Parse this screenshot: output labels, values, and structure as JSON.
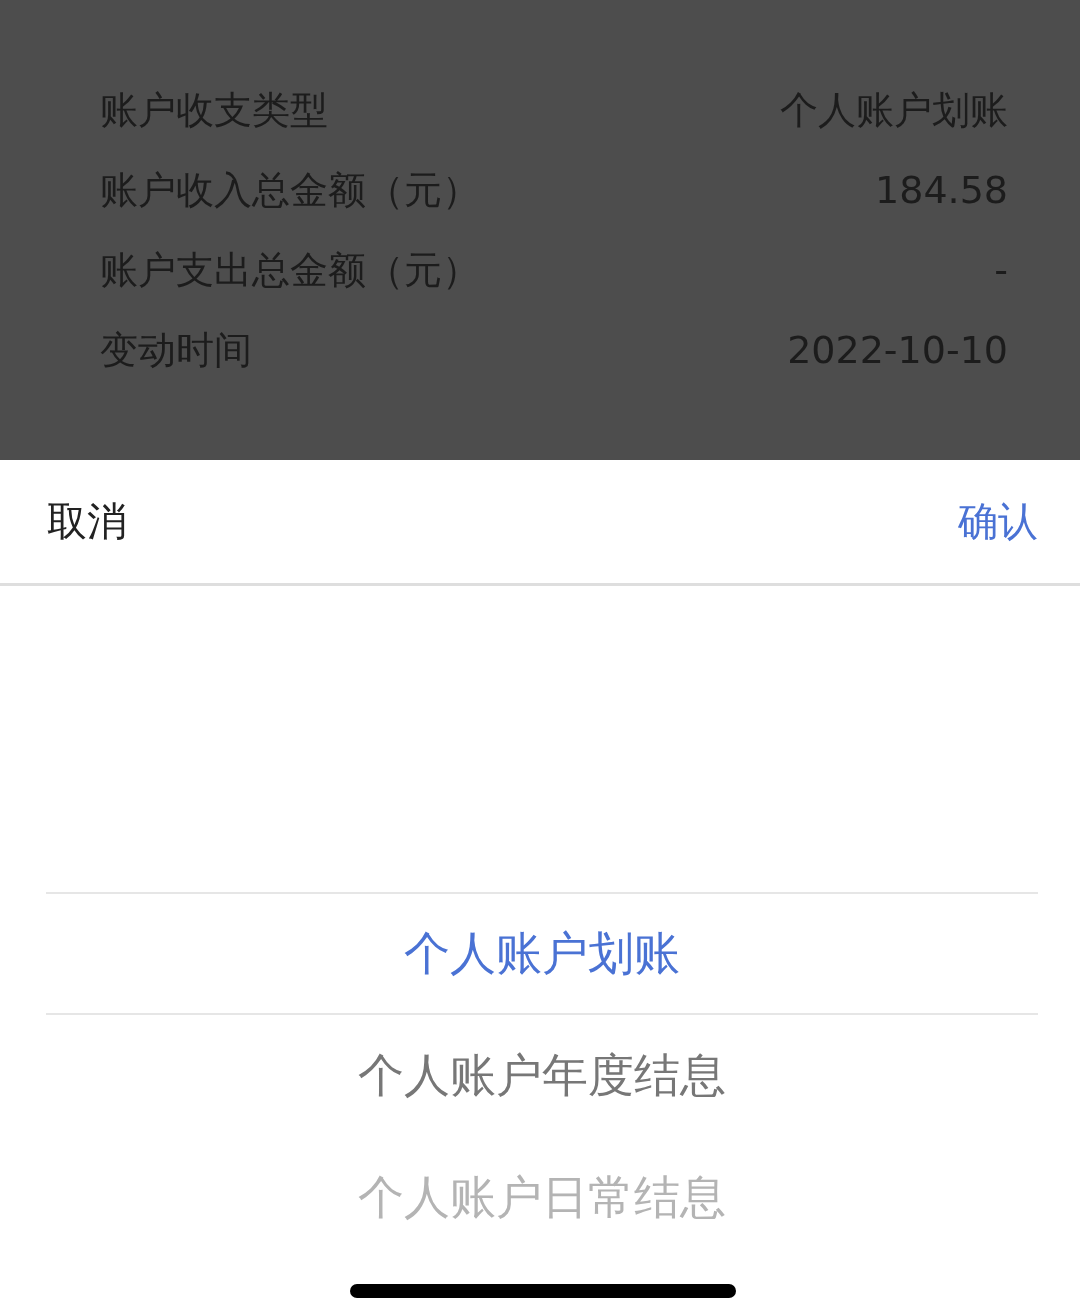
{
  "details": [
    {
      "label": "账户收支类型",
      "value": "个人账户划账"
    },
    {
      "label": "账户收入总金额（元）",
      "value": "184.58"
    },
    {
      "label": "账户支出总金额（元）",
      "value": "-"
    },
    {
      "label": "变动时间",
      "value": "2022-10-10"
    }
  ],
  "sheet": {
    "cancel": "取消",
    "confirm": "确认"
  },
  "picker": {
    "options": [
      {
        "label": "个人账户划账",
        "selected": true
      },
      {
        "label": "个人账户年度结息",
        "selected": false
      },
      {
        "label": "个人账户日常结息",
        "selected": false
      }
    ]
  }
}
